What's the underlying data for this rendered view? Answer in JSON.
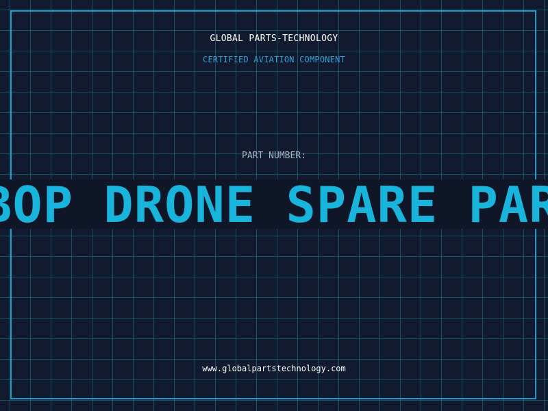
{
  "header": {
    "company": "GLOBAL PARTS-TECHNOLOGY",
    "subtitle": "CERTIFIED AVIATION COMPONENT"
  },
  "part": {
    "label": "PART NUMBER:",
    "number": "BOP DRONE SPARE PAR"
  },
  "footer": {
    "website": "www.globalpartstechnology.com"
  },
  "colors": {
    "background": "#111a2e",
    "grid": "#26789a",
    "accent": "#19b4dc",
    "frame": "#1a9bc8"
  }
}
